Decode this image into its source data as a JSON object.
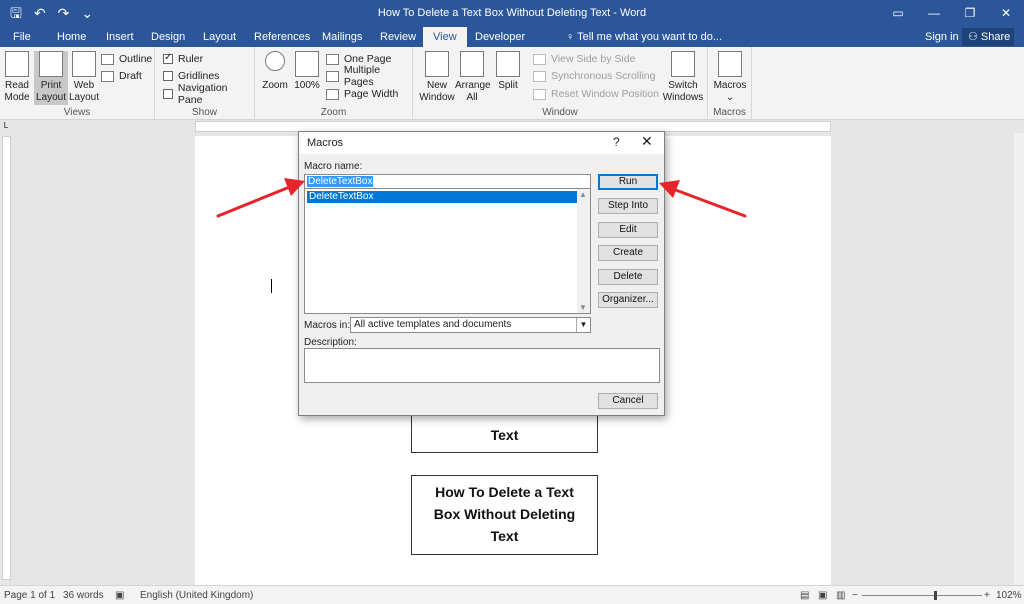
{
  "window": {
    "title": "How To Delete a Text Box Without Deleting Text - Word",
    "controls": [
      "▭",
      "—",
      "❐",
      "✕"
    ]
  },
  "qat": {
    "save": "🖫",
    "undo": "↶",
    "redo": "↷",
    "more": "⌄"
  },
  "tabs": [
    "File",
    "Home",
    "Insert",
    "Design",
    "Layout",
    "References",
    "Mailings",
    "Review",
    "View",
    "Developer"
  ],
  "tell_me": "♀ Tell me what you want to do...",
  "sign_in": "Sign in",
  "share": "Share",
  "ribbon": {
    "views": {
      "label": "Views",
      "read_mode": "Read Mode",
      "print_layout": "Print Layout",
      "web_layout": "Web Layout",
      "outline": "Outline",
      "draft": "Draft"
    },
    "show": {
      "label": "Show",
      "ruler": "Ruler",
      "gridlines": "Gridlines",
      "navigation_pane": "Navigation Pane"
    },
    "zoom": {
      "label": "Zoom",
      "zoom": "Zoom",
      "hundred": "100%",
      "one_page": "One Page",
      "multiple_pages": "Multiple Pages",
      "page_width": "Page Width"
    },
    "window": {
      "label": "Window",
      "new_window": "New Window",
      "arrange_all": "Arrange All",
      "split": "Split",
      "view_side_by_side": "View Side by Side",
      "synchronous_scrolling": "Synchronous Scrolling",
      "reset_window_position": "Reset Window Position",
      "switch_windows": "Switch Windows"
    },
    "macros": {
      "label": "Macros",
      "macros": "Macros"
    }
  },
  "document": {
    "textbox_lower": "How To Delete a Text Box Without Deleting Text",
    "textbox_upper_tail": "Text"
  },
  "dialog": {
    "title": "Macros",
    "help": "?",
    "close": "✕",
    "macro_name_label": "Macro name:",
    "macro_name_value": "DeleteTextBox",
    "list_items": [
      "DeleteTextBox"
    ],
    "macros_in_label": "Macros in:",
    "macros_in_value": "All active templates and documents",
    "description_label": "Description:",
    "buttons": {
      "run": "Run",
      "step_into": "Step Into",
      "edit": "Edit",
      "create": "Create",
      "delete": "Delete",
      "organizer": "Organizer...",
      "cancel": "Cancel"
    }
  },
  "status": {
    "page": "Page 1 of 1",
    "words": "36 words",
    "language": "English (United Kingdom)",
    "zoom": "102%"
  },
  "colors": {
    "accent": "#2b579a",
    "selection": "#0078d7",
    "annotation_arrow": "#e8242b"
  }
}
